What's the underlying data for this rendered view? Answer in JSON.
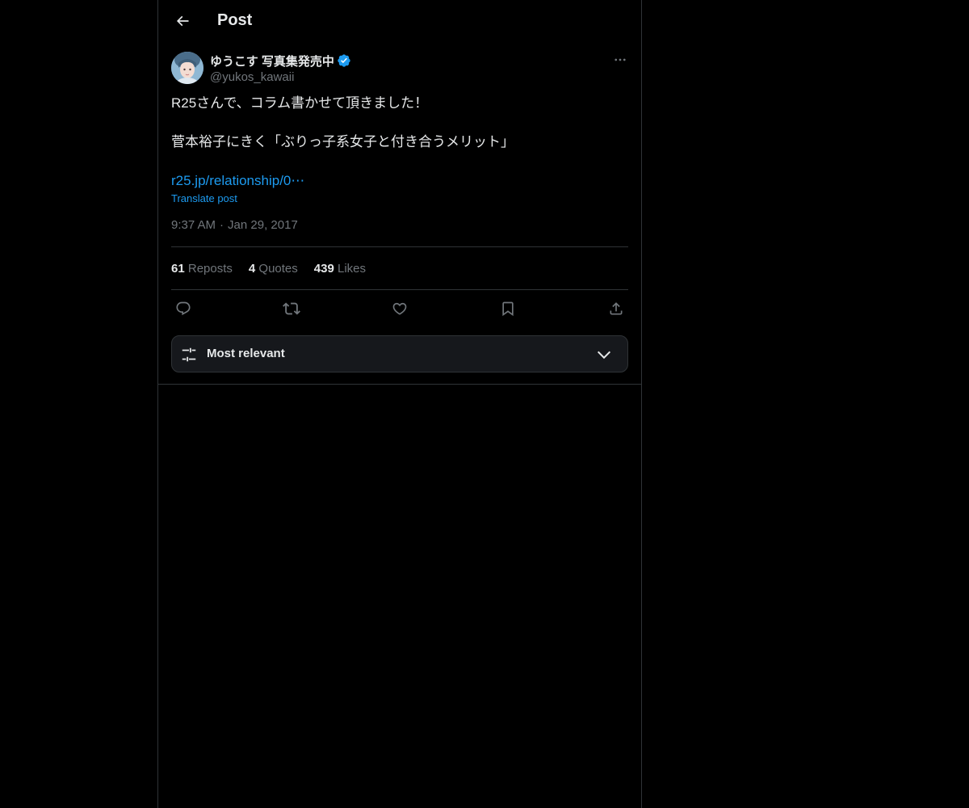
{
  "header": {
    "title": "Post",
    "back_icon": "arrow-left-icon"
  },
  "post": {
    "author": {
      "display_name": "ゆうこす 写真集発売中",
      "handle": "@yukos_kawaii",
      "verified": true
    },
    "text_lines": [
      "R25さんで、コラム書かせて頂きました！",
      "",
      "菅本裕子にきく「ぶりっ子系女子と付き合うメリット」",
      ""
    ],
    "link_text": "r25.jp/relationship/0⋯",
    "translate_label": "Translate post",
    "time": "9:37 AM",
    "separator": "·",
    "date": "Jan 29, 2017",
    "stats": {
      "reposts_count": "61",
      "reposts_label": "Reposts",
      "quotes_count": "4",
      "quotes_label": "Quotes",
      "likes_count": "439",
      "likes_label": "Likes"
    },
    "actions": [
      "reply-icon",
      "repost-icon",
      "like-icon",
      "bookmark-icon",
      "share-icon"
    ]
  },
  "sort": {
    "label": "Most relevant"
  },
  "colors": {
    "background": "#000000",
    "text": "#e7e9ea",
    "muted": "#71767b",
    "accent": "#1d9bf0",
    "border": "#2f3336"
  }
}
